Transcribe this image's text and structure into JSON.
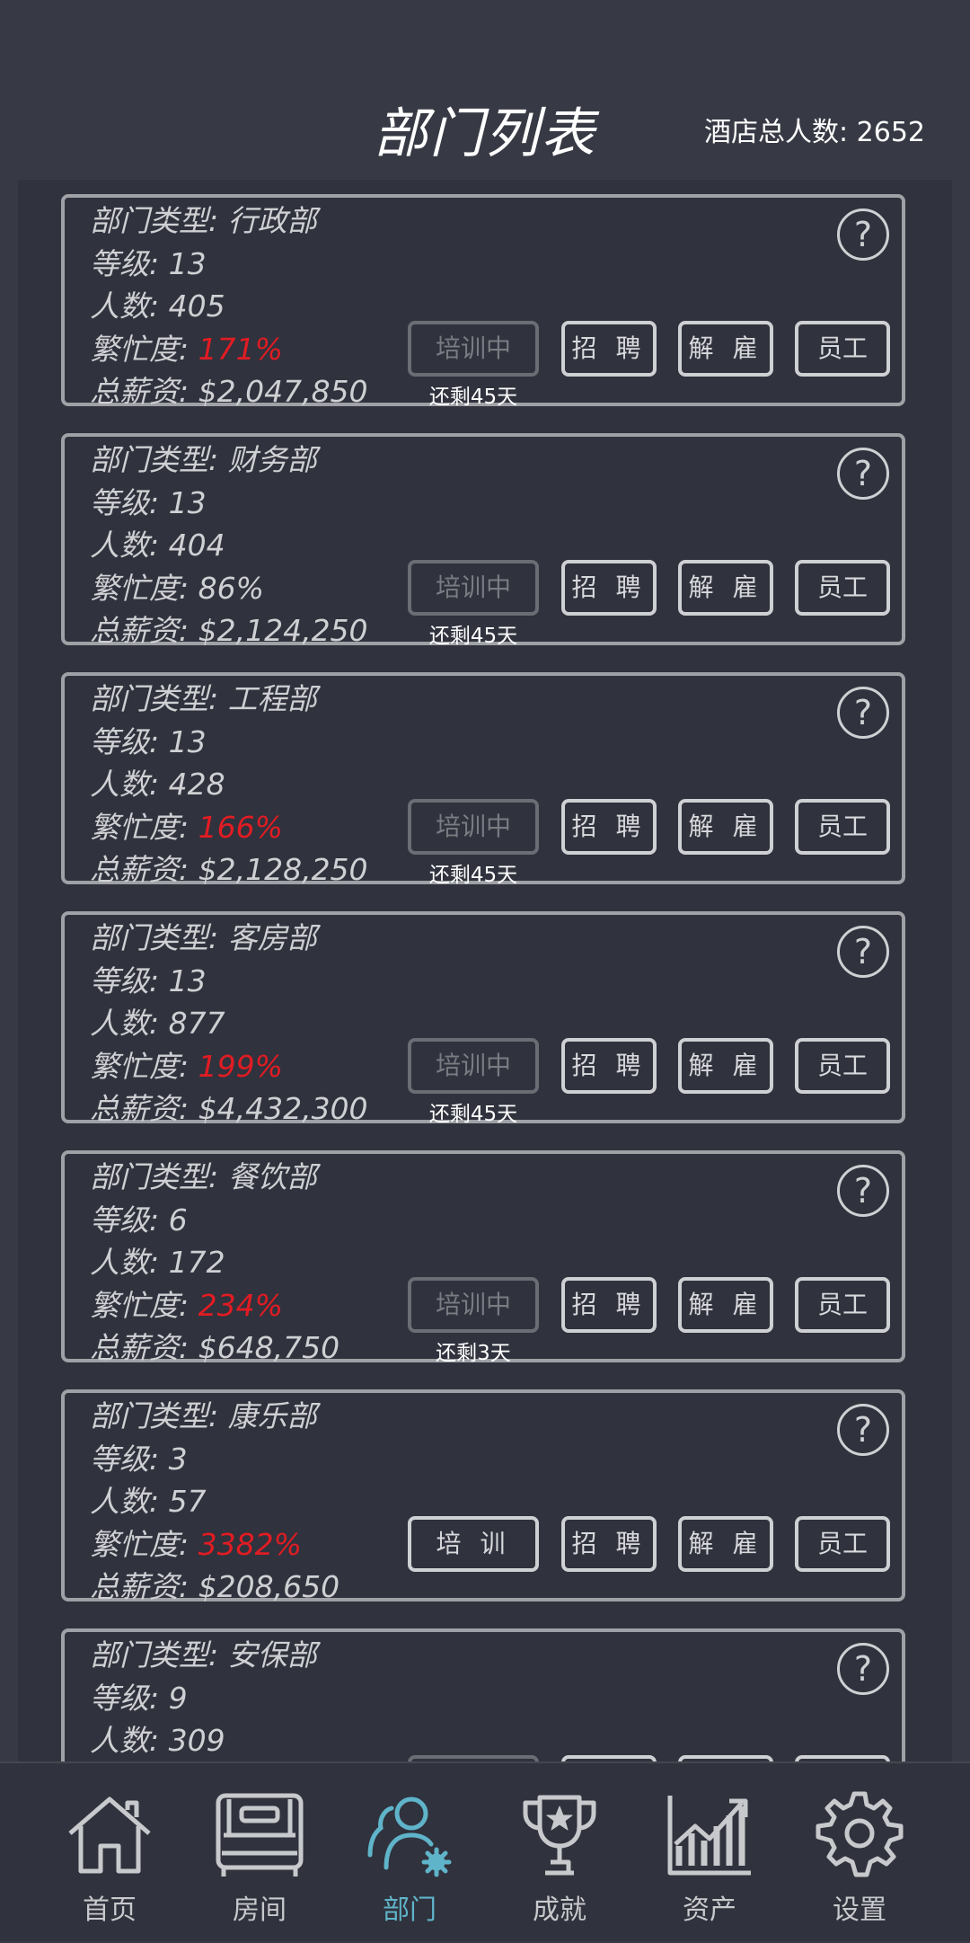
{
  "header": {
    "title": "部门列表",
    "total_staff": "酒店总人数: 2652"
  },
  "help_glyph": "?",
  "departments": [
    {
      "type": "部门类型: 行政部",
      "level": "等级: 13",
      "count": "人数: 405",
      "busy_label": "繁忙度: ",
      "busy_value": "171%",
      "salary": "总薪资: $2,047,850",
      "train_label": "培训中",
      "remaining": "还剩45天",
      "hire_label": "招 聘",
      "fire_label": "解 雇",
      "staff_label": "员工"
    },
    {
      "type": "部门类型: 财务部",
      "level": "等级: 13",
      "count": "人数: 404",
      "busy_label": "繁忙度: ",
      "busy_value": "86%",
      "salary": "总薪资: $2,124,250",
      "train_label": "培训中",
      "remaining": "还剩45天",
      "hire_label": "招 聘",
      "fire_label": "解 雇",
      "staff_label": "员工"
    },
    {
      "type": "部门类型: 工程部",
      "level": "等级: 13",
      "count": "人数: 428",
      "busy_label": "繁忙度: ",
      "busy_value": "166%",
      "salary": "总薪资: $2,128,250",
      "train_label": "培训中",
      "remaining": "还剩45天",
      "hire_label": "招 聘",
      "fire_label": "解 雇",
      "staff_label": "员工"
    },
    {
      "type": "部门类型: 客房部",
      "level": "等级: 13",
      "count": "人数: 877",
      "busy_label": "繁忙度: ",
      "busy_value": "199%",
      "salary": "总薪资: $4,432,300",
      "train_label": "培训中",
      "remaining": "还剩45天",
      "hire_label": "招 聘",
      "fire_label": "解 雇",
      "staff_label": "员工"
    },
    {
      "type": "部门类型: 餐饮部",
      "level": "等级: 6",
      "count": "人数: 172",
      "busy_label": "繁忙度: ",
      "busy_value": "234%",
      "salary": "总薪资: $648,750",
      "train_label": "培训中",
      "remaining": "还剩3天",
      "hire_label": "招 聘",
      "fire_label": "解 雇",
      "staff_label": "员工"
    },
    {
      "type": "部门类型: 康乐部",
      "level": "等级: 3",
      "count": "人数: 57",
      "busy_label": "繁忙度: ",
      "busy_value": "3382%",
      "salary": "总薪资: $208,650",
      "train_label": "培 训",
      "remaining": "",
      "hire_label": "招 聘",
      "fire_label": "解 雇",
      "staff_label": "员工"
    },
    {
      "type": "部门类型: 安保部",
      "level": "等级: 9",
      "count": "人数: 309",
      "busy_label": "",
      "busy_value": "",
      "salary": "",
      "train_label": "",
      "remaining": "",
      "hire_label": "",
      "fire_label": "",
      "staff_label": ""
    }
  ],
  "nav": {
    "home": "首页",
    "rooms": "房间",
    "departments": "部门",
    "achievements": "成就",
    "assets": "资产",
    "settings": "设置"
  },
  "colors": {
    "background": "#373a44",
    "panel": "#30323d",
    "alert_red": "#e11c23",
    "active_nav": "#5fb4c9"
  }
}
